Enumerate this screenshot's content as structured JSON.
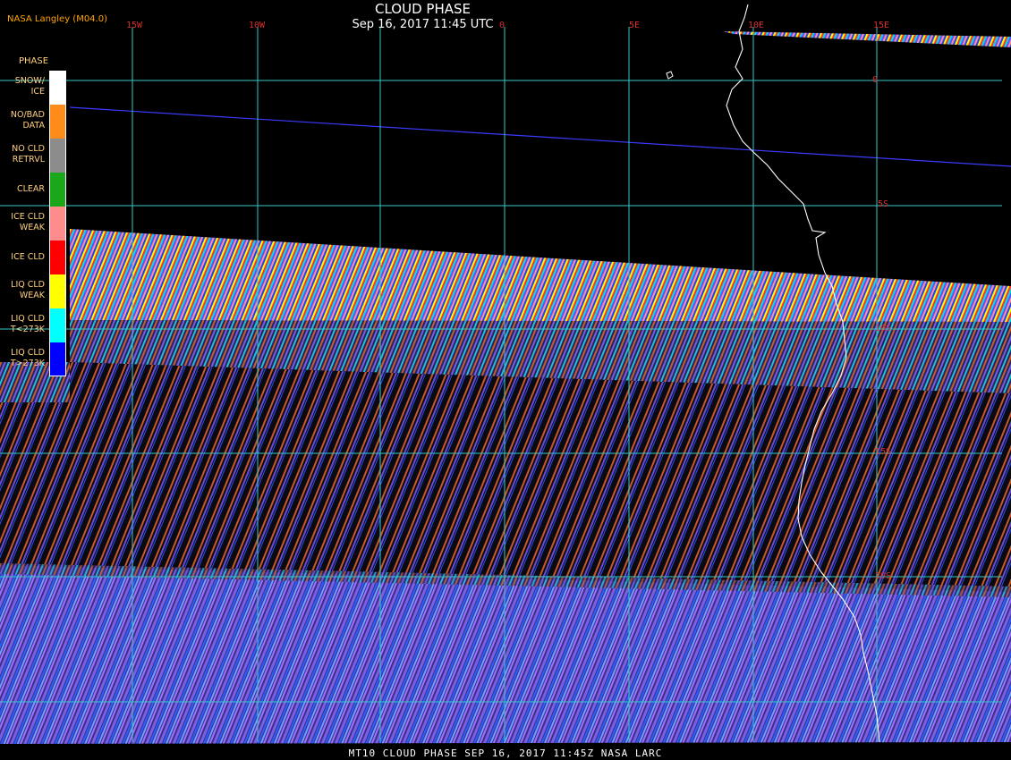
{
  "header": {
    "title": "CLOUD PHASE",
    "datetime": "Sep 16, 2017 11:45 UTC",
    "version": "NASA Langley (M04.0)"
  },
  "footer": {
    "caption": "MT10  CLOUD PHASE   SEP 16, 2017 11:45Z   NASA LARC"
  },
  "grid": {
    "longitudes": [
      "15W",
      "10W",
      "0",
      "5E",
      "10E",
      "15E"
    ],
    "latitudes": [
      "0",
      "5S",
      "10S",
      "15S",
      "20S"
    ]
  },
  "legend": {
    "title": "PHASE",
    "items": [
      {
        "label": "SNOW/\nICE",
        "color": "#ffffff"
      },
      {
        "label": "NO/BAD\nDATA",
        "color": "#ff8c1a"
      },
      {
        "label": "NO CLD\nRETRVL",
        "color": "#8c8c8c"
      },
      {
        "label": "CLEAR",
        "color": "#1aa81a"
      },
      {
        "label": "ICE CLD\nWEAK",
        "color": "#ff8c8c"
      },
      {
        "label": "ICE CLD",
        "color": "#ff0000"
      },
      {
        "label": "LIQ CLD\nWEAK",
        "color": "#ffff00"
      },
      {
        "label": "LIQ CLD\nT<273K",
        "color": "#00ffff"
      },
      {
        "label": "LIQ CLD\nT>273K",
        "color": "#0000ff"
      }
    ]
  },
  "colors": {
    "gridline": "#36c9c9",
    "coastline": "#ffffff",
    "equator_line": "#3b3bff",
    "background": "#000000",
    "stripe_violet": "#6a4bd0",
    "stripe_orange": "#d9632a"
  }
}
